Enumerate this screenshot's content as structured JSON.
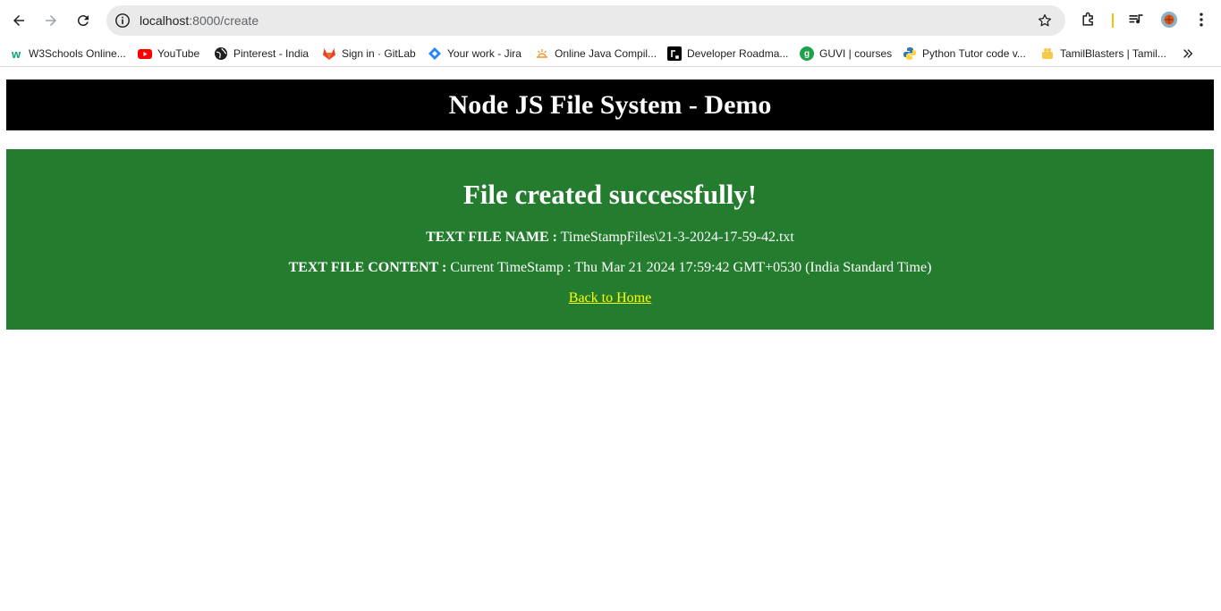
{
  "browser": {
    "url_host": "localhost",
    "url_path": ":8000/create",
    "bookmarks": [
      {
        "label": "W3Schools Online...",
        "icon": "w3schools-icon"
      },
      {
        "label": "YouTube",
        "icon": "youtube-icon"
      },
      {
        "label": "Pinterest - India",
        "icon": "globe-icon"
      },
      {
        "label": "Sign in · GitLab",
        "icon": "gitlab-icon"
      },
      {
        "label": "Your work - Jira",
        "icon": "jira-icon"
      },
      {
        "label": "Online Java Compil...",
        "icon": "java-compiler-icon"
      },
      {
        "label": "Developer Roadma...",
        "icon": "roadmap-icon"
      },
      {
        "label": "GUVI | courses",
        "icon": "guvi-icon"
      },
      {
        "label": "Python Tutor code v...",
        "icon": "python-icon"
      },
      {
        "label": "TamilBlasters | Tamil...",
        "icon": "tamilblasters-icon"
      }
    ]
  },
  "page": {
    "header_title": "Node JS File System - Demo",
    "result_title": "File created successfully!",
    "file_name_label": "TEXT FILE NAME :",
    "file_name_value": " TimeStampFiles\\21-3-2024-17-59-42.txt",
    "file_content_label": "TEXT FILE CONTENT :",
    "file_content_value": " Current TimeStamp : Thu Mar 21 2024 17:59:42 GMT+0530 (India Standard Time)",
    "back_link": "Back to Home"
  },
  "colors": {
    "header_bg": "#000000",
    "result_bg": "#247d2e",
    "link": "#ffff00"
  }
}
